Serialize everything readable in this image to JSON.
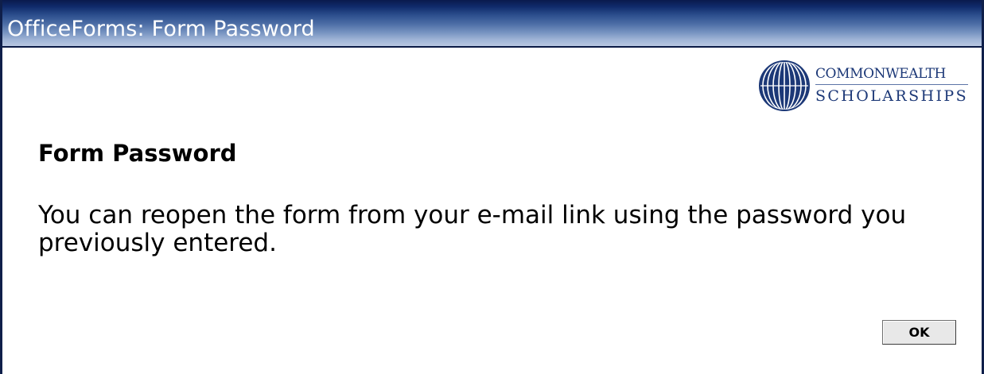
{
  "window": {
    "title": "OfficeForms: Form Password"
  },
  "logo": {
    "line1": "COMMONWEALTH",
    "line2": "SCHOLARSHIPS",
    "icon": "globe-icon"
  },
  "dialog": {
    "heading": "Form Password",
    "message": "You can reopen the form from your e-mail link using the password you previously entered.",
    "ok_label": "OK"
  },
  "colors": {
    "titlebar_dark": "#0a1a4c",
    "titlebar_light": "#b9c8e2",
    "logo_blue": "#1c3877",
    "button_face": "#e8e8e8"
  }
}
